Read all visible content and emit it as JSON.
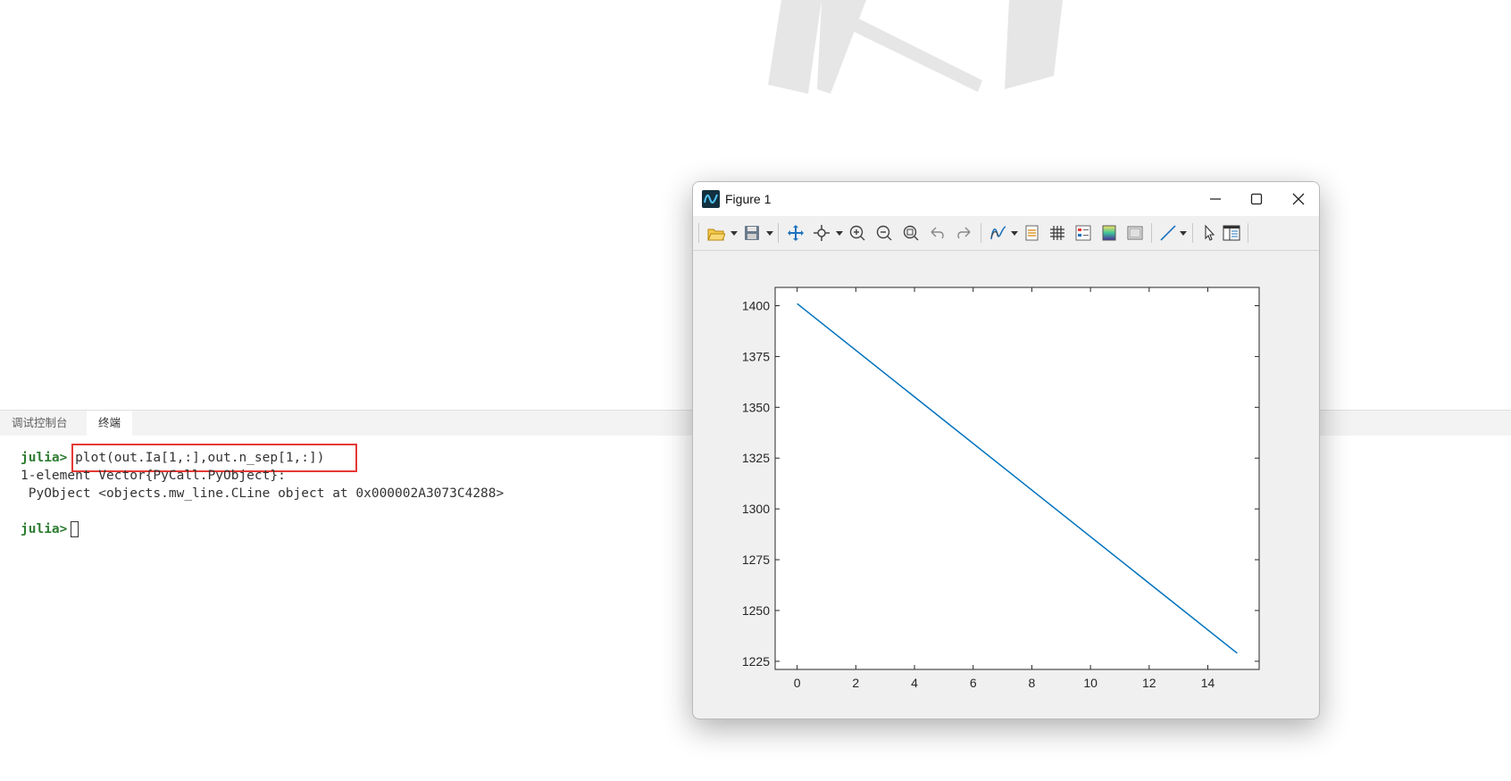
{
  "panel": {
    "tabs": [
      {
        "label": "调试控制台",
        "active": false
      },
      {
        "label": "终端",
        "active": true
      }
    ]
  },
  "terminal": {
    "prompt": "julia>",
    "command": "plot(out.Ia[1,:],out.n_sep[1,:])",
    "output_lines": [
      "1-element Vector{PyCall.PyObject}:",
      " PyObject <objects.mw_line.CLine object at 0x000002A3073C4288>"
    ],
    "prompt2": "julia>",
    "highlight_color": "#e53935",
    "prompt_color": "#2e7d32"
  },
  "figure": {
    "title": "Figure 1",
    "toolbar_icons": [
      "open-file-icon",
      "save-icon",
      "pan-icon",
      "data-cursor-icon",
      "zoom-in-icon",
      "zoom-out-icon",
      "zoom-fit-icon",
      "undo-icon",
      "redo-icon",
      "plot-style-icon",
      "legend-icon",
      "grid-icon",
      "property-editor-icon",
      "colorbar-icon",
      "axes-frame-icon",
      "line-tool-icon",
      "select-pointer-icon",
      "panel-layout-icon"
    ]
  },
  "chart_data": {
    "type": "line",
    "title": "",
    "xlabel": "",
    "ylabel": "",
    "x": [
      0,
      15
    ],
    "y": [
      1401,
      1229
    ],
    "xlim": [
      -0.75,
      15.75
    ],
    "ylim": [
      1221,
      1409
    ],
    "xticks": [
      0,
      2,
      4,
      6,
      8,
      10,
      12,
      14
    ],
    "yticks": [
      1225,
      1250,
      1275,
      1300,
      1325,
      1350,
      1375,
      1400
    ],
    "line_color": "#0072bd",
    "grid": false
  }
}
